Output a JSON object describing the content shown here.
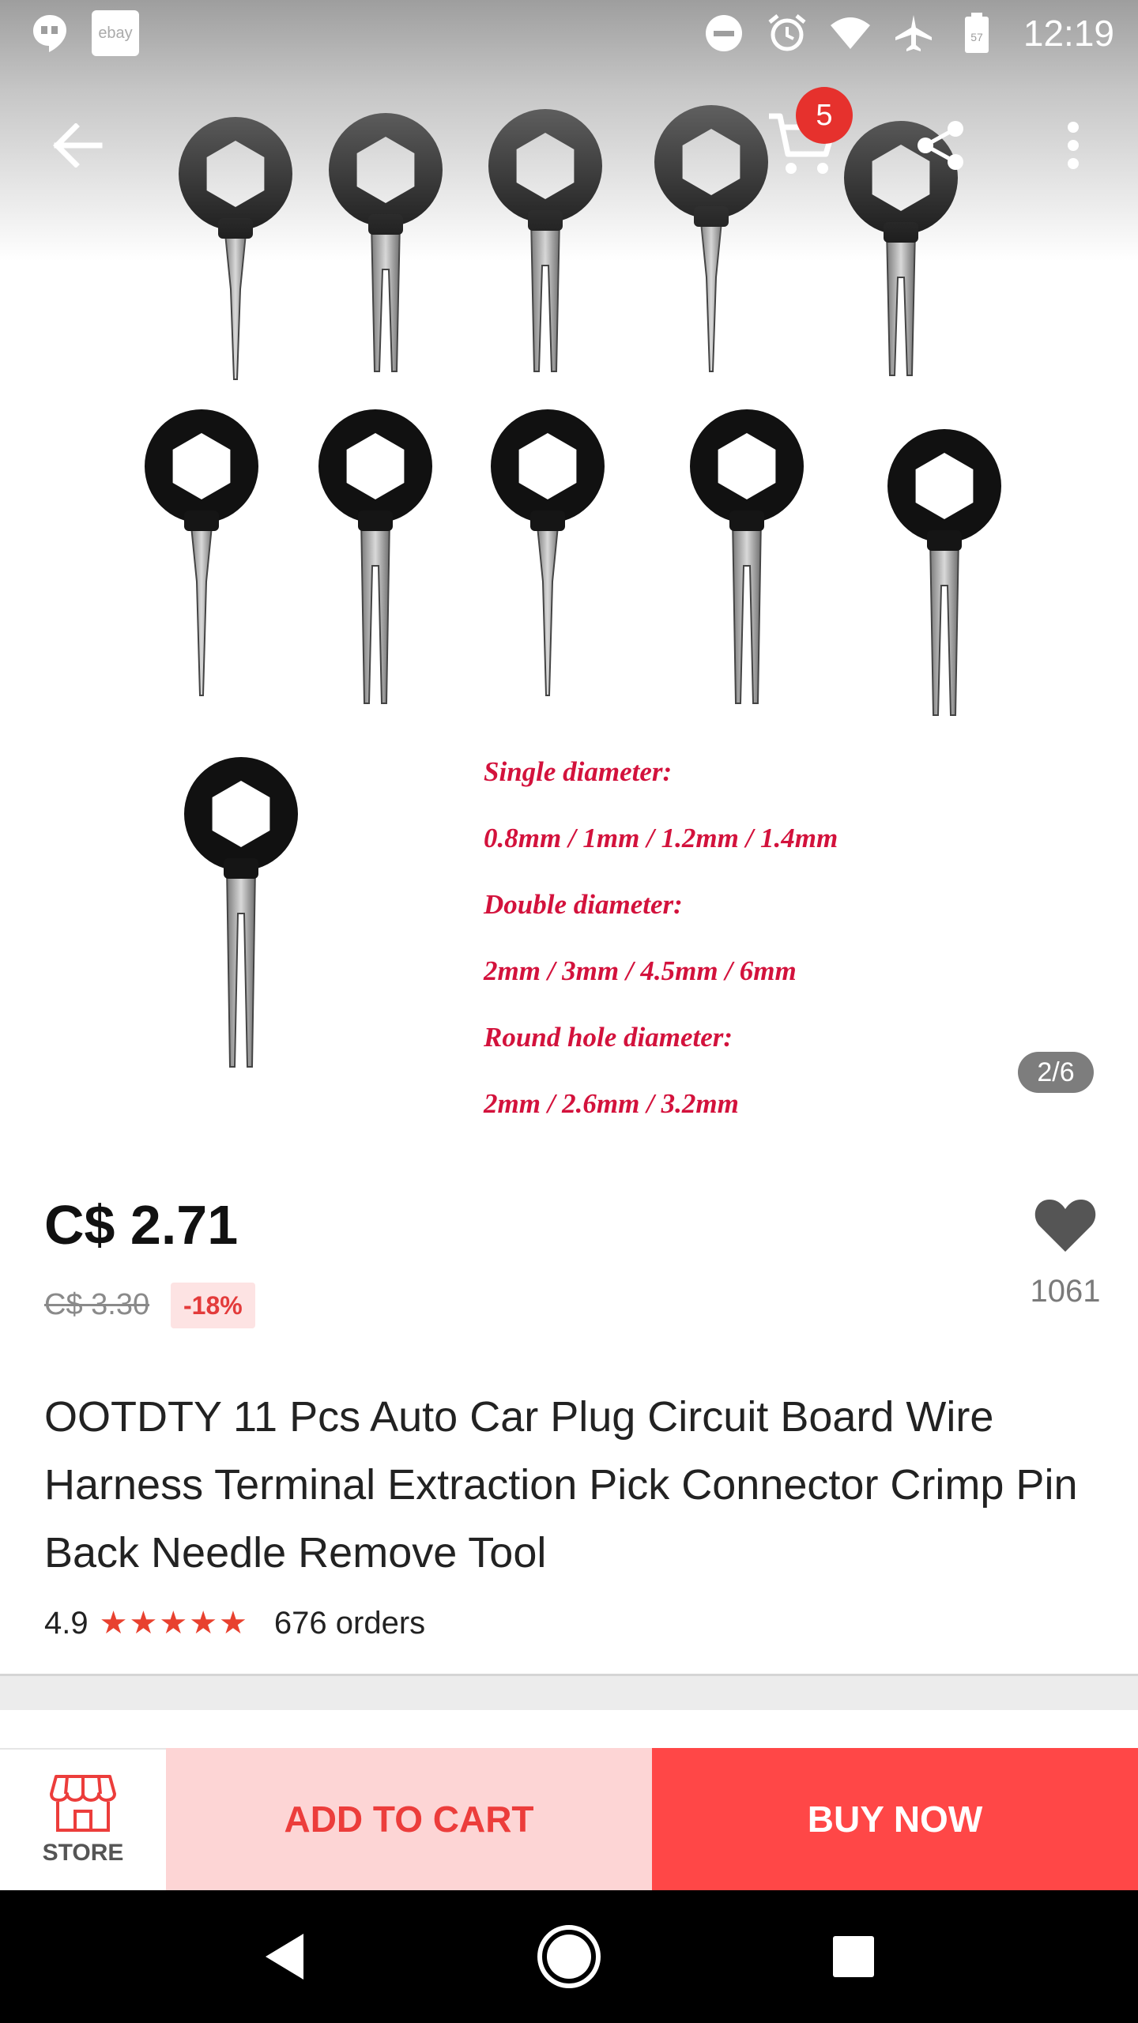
{
  "status_bar": {
    "time": "12:19",
    "ebay_label": "ebay",
    "battery_level": "57",
    "icons": [
      "hangouts-icon",
      "ebay-icon",
      "dnd-icon",
      "alarm-icon",
      "wifi-icon",
      "airplane-icon",
      "battery-icon"
    ]
  },
  "gallery": {
    "indicator": "2/6",
    "spec_lines": [
      "Single diameter:",
      "0.8mm / 1mm / 1.2mm / 1.4mm",
      "Double diameter:",
      "2mm / 3mm / 4.5mm / 6mm",
      "Round hole diameter:",
      "2mm / 2.6mm / 3.2mm"
    ],
    "spec_color": "#d3123c"
  },
  "top_bar": {
    "cart_count": "5",
    "icons": [
      "back-arrow-icon",
      "cart-icon",
      "share-icon",
      "more-vert-icon"
    ]
  },
  "product": {
    "price": "C$ 2.71",
    "old_price": "C$ 3.30",
    "discount": "-18%",
    "wishlist_count": "1061",
    "title": "OOTDTY 11 Pcs Auto Car Plug Circuit Board Wire Harness Terminal Extraction Pick Connector Crimp Pin Back Needle Remove Tool",
    "rating": "4.9",
    "stars": 5,
    "orders": "676 orders"
  },
  "actions": {
    "store_label": "STORE",
    "add_to_cart": "ADD TO CART",
    "buy_now": "BUY NOW"
  },
  "colors": {
    "accent": "#ff4747",
    "accent_light": "#fdd5d5",
    "star": "#e8412f",
    "badge": "#e6312d"
  }
}
